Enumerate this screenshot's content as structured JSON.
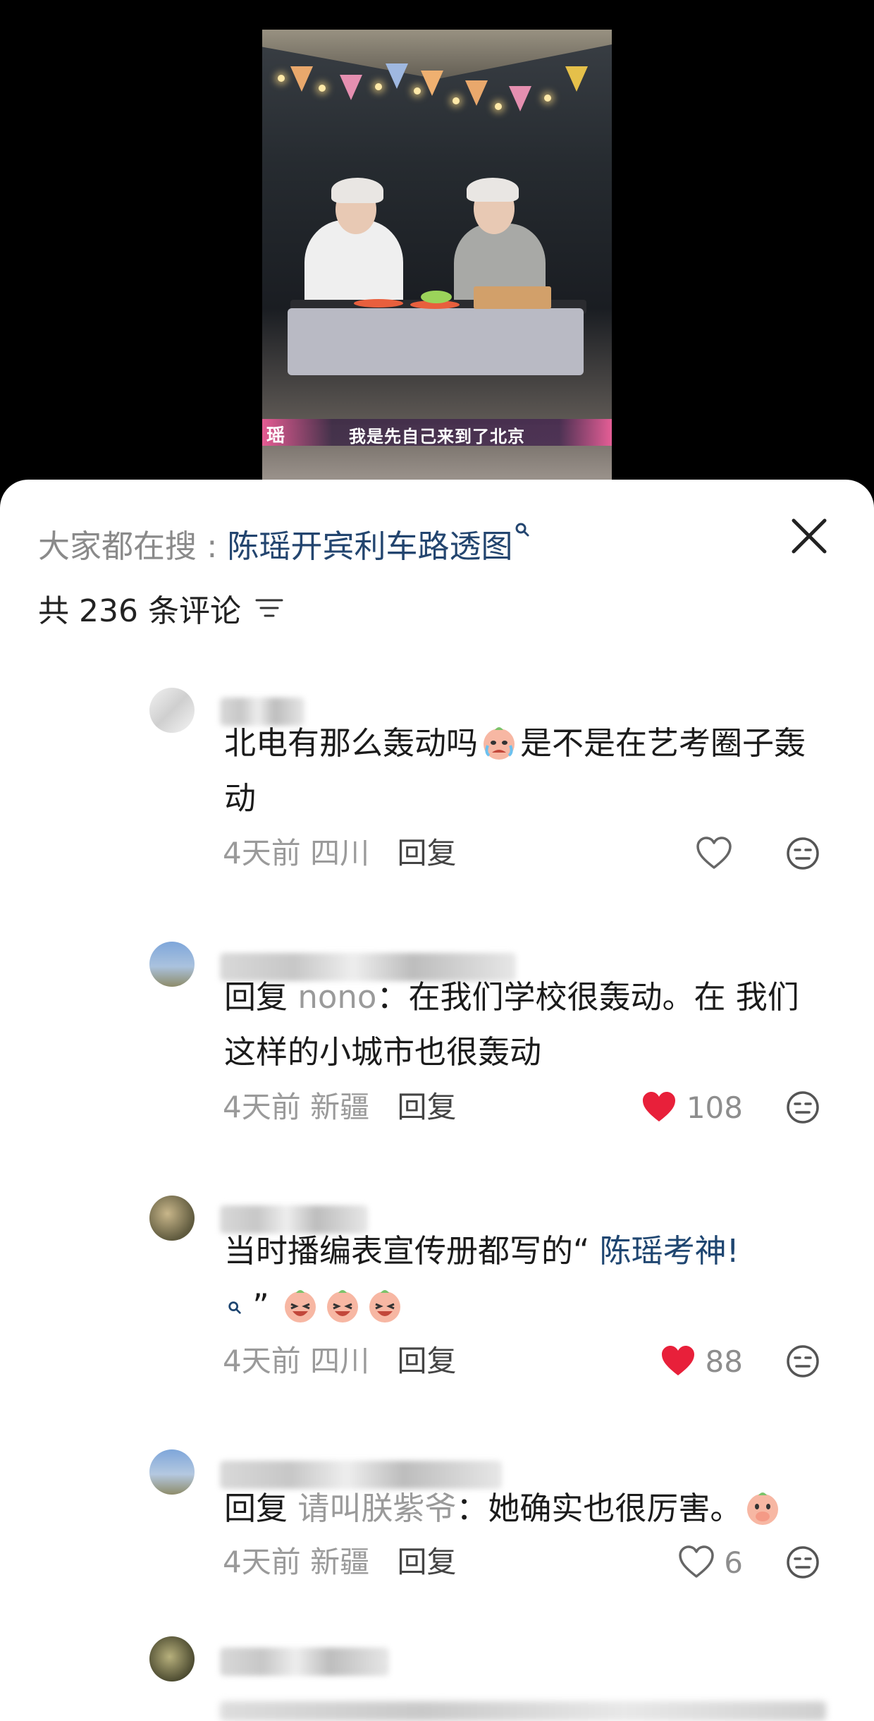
{
  "video": {
    "caption_name": "瑶",
    "caption_text": "我是先自己来到了北京"
  },
  "sheet": {
    "search_prefix": "大家都在搜 :",
    "search_term": "陈瑶开宾利车路透图",
    "comment_count_label": "共 236 条评论"
  },
  "comments": [
    {
      "text": "北电有那么轰动吗",
      "text_after_emoji": "是不是在艺考圈子轰动",
      "time": "4天前",
      "location": "四川",
      "reply_label": "回复",
      "likes": "",
      "liked": false
    },
    {
      "reply_prefix": "回复",
      "reply_target": "nono",
      "text": "：在我们学校很轰动。在 我们这样的小城市也很轰动",
      "time": "4天前",
      "location": "新疆",
      "reply_label": "回复",
      "likes": "108",
      "liked": true
    },
    {
      "text": "当时播编表宣传册都写的“",
      "highlight": "陈瑶考神!",
      "text_end": "”",
      "time": "4天前",
      "location": "四川",
      "reply_label": "回复",
      "likes": "88",
      "liked": true
    },
    {
      "reply_prefix": "回复",
      "reply_target": "请叫朕紫爷",
      "text": "：她确实也很厉害。",
      "time": "4天前",
      "location": "新疆",
      "reply_label": "回复",
      "likes": "6",
      "liked": false
    }
  ],
  "colors": {
    "accent_link": "#1f4671",
    "like_red": "#e8203a",
    "muted": "#9a9a9a"
  }
}
